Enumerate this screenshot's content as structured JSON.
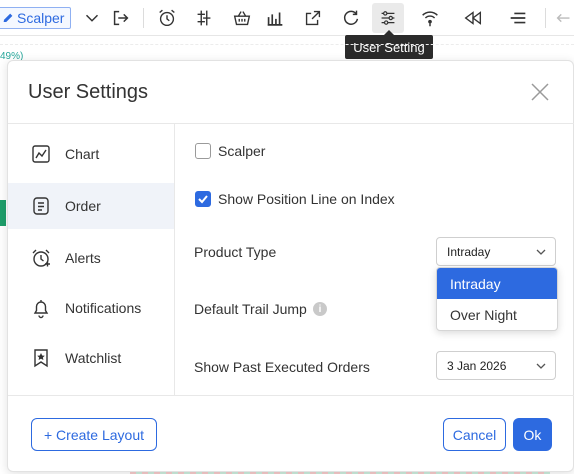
{
  "toolbar": {
    "scalper_label": "Scalper",
    "tooltip": "User Setting",
    "icons": [
      "edit-pen-icon",
      "chevron-down-icon",
      "exit-icon",
      "alarm-add-icon",
      "candle-settings-icon",
      "basket-icon",
      "bar-chart-icon",
      "external-link-icon",
      "refresh-icon",
      "sliders-icon",
      "broadcast-icon",
      "rewind-icon",
      "menu-icon",
      "undo-icon"
    ]
  },
  "background": {
    "price_fragment": "49%)"
  },
  "dialog": {
    "title": "User Settings",
    "nav": [
      {
        "label": "Chart",
        "icon": "chart-icon"
      },
      {
        "label": "Order",
        "icon": "document-icon"
      },
      {
        "label": "Alerts",
        "icon": "alarm-icon"
      },
      {
        "label": "Notifications",
        "icon": "bell-icon"
      },
      {
        "label": "Watchlist",
        "icon": "bookmark-star-icon"
      }
    ],
    "selected_nav": "Order",
    "settings": {
      "scalper_label": "Scalper",
      "scalper_checked": false,
      "position_line_label": "Show Position Line on Index",
      "position_line_checked": true,
      "product_type_label": "Product Type",
      "product_type_value": "Intraday",
      "product_type_options": [
        "Intraday",
        "Over Night"
      ],
      "trail_jump_label": "Default Trail Jump",
      "past_orders_label": "Show Past Executed Orders",
      "past_orders_value": "3 Jan 2026"
    },
    "footer": {
      "create_layout": "+ Create Layout",
      "cancel": "Cancel",
      "ok": "Ok"
    }
  },
  "colors": {
    "accent": "#2d6ae0",
    "selected_nav_bg": "#f0f3f9",
    "tooltip_bg": "#2b2b2b"
  }
}
